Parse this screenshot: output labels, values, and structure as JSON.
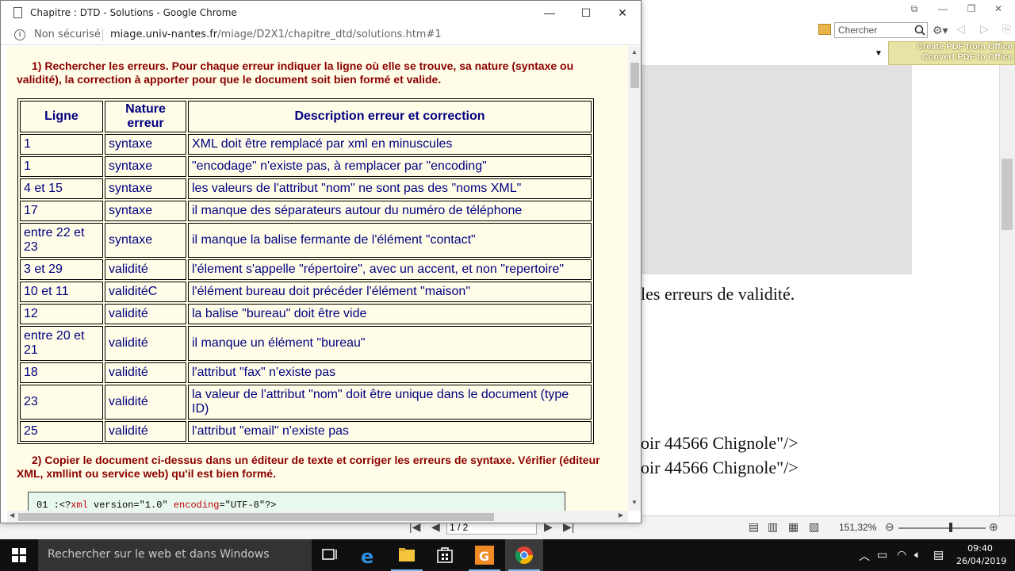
{
  "background_app": {
    "search_placeholder": "Chercher",
    "pdf_banner_line1": "Create PDF from Office",
    "pdf_banner_line2": "Convert PDF to Office",
    "doc_text_validite": "les erreurs de validité.",
    "doc_code_line1": "oir 44566 Chignole\"/>",
    "doc_code_line2": "oir 44566 Chignole\"/>",
    "page_indicator": "1 / 2",
    "zoom_level": "151,32%"
  },
  "chrome": {
    "window_title": "Chapitre : DTD - Solutions - Google Chrome",
    "not_secure": "Non sécurisé",
    "url_host": "miage.univ-nantes.fr",
    "url_path": "/miage/D2X1/chapitre_dtd/solutions.htm#1"
  },
  "page": {
    "question1": "1) Rechercher les erreurs. Pour chaque erreur indiquer la ligne où elle se trouve, sa nature (syntaxe ou validité), la correction à apporter pour que le document soit bien formé et valide.",
    "table": {
      "headers": [
        "Ligne",
        "Nature erreur",
        "Description erreur et correction"
      ],
      "rows": [
        {
          "ligne": "1",
          "nature": "syntaxe",
          "description": "XML doit être remplacé par xml en minuscules"
        },
        {
          "ligne": "1",
          "nature": "syntaxe",
          "description": "\"encodage\" n'existe pas, à remplacer par \"encoding\""
        },
        {
          "ligne": "4 et 15",
          "nature": "syntaxe",
          "description": "les valeurs de l'attribut \"nom\" ne sont pas des \"noms XML\""
        },
        {
          "ligne": "17",
          "nature": "syntaxe",
          "description": "il manque des séparateurs autour du numéro de téléphone"
        },
        {
          "ligne": "entre 22 et 23",
          "nature": "syntaxe",
          "description": "il manque la balise fermante de l'élément \"contact\""
        },
        {
          "ligne": "3 et 29",
          "nature": "validité",
          "description": "l'élement s'appelle \"répertoire\", avec un accent, et non \"repertoire\""
        },
        {
          "ligne": "10 et 11",
          "nature": "validitéC",
          "description": "l'élément bureau doit précéder l'élément \"maison\""
        },
        {
          "ligne": "12",
          "nature": "validité",
          "description": "la balise \"bureau\" doit être vide"
        },
        {
          "ligne": "entre 20 et 21",
          "nature": "validité",
          "description": "il manque un élément \"bureau\""
        },
        {
          "ligne": "18",
          "nature": "validité",
          "description": "l'attribut \"fax\" n'existe pas"
        },
        {
          "ligne": "23",
          "nature": "validité",
          "description": "la valeur de l'attribut \"nom\" doit être unique dans le document (type ID)"
        },
        {
          "ligne": "25",
          "nature": "validité",
          "description": "l'attribut \"email\" n'existe pas"
        }
      ]
    },
    "question2": "2) Copier le document ci-dessus dans un éditeur de texte et corriger les erreurs de syntaxe. Vérifier (éditeur XML, xmllint ou service web) qu'il est bien formé.",
    "code": {
      "prefix": "01 :<?",
      "kw1": "xml",
      "mid1": " version=\"1.0\" ",
      "kw2": "encoding",
      "mid2": "=\"UTF-8\"?>"
    }
  },
  "taskbar": {
    "search_text": "Rechercher sur le web et dans Windows",
    "time": "09:40",
    "date": "26/04/2019"
  },
  "colors": {
    "page_background": "#fffde7",
    "question_text": "#8b0000",
    "table_text": "#000080",
    "code_background": "#e8f8ef"
  }
}
